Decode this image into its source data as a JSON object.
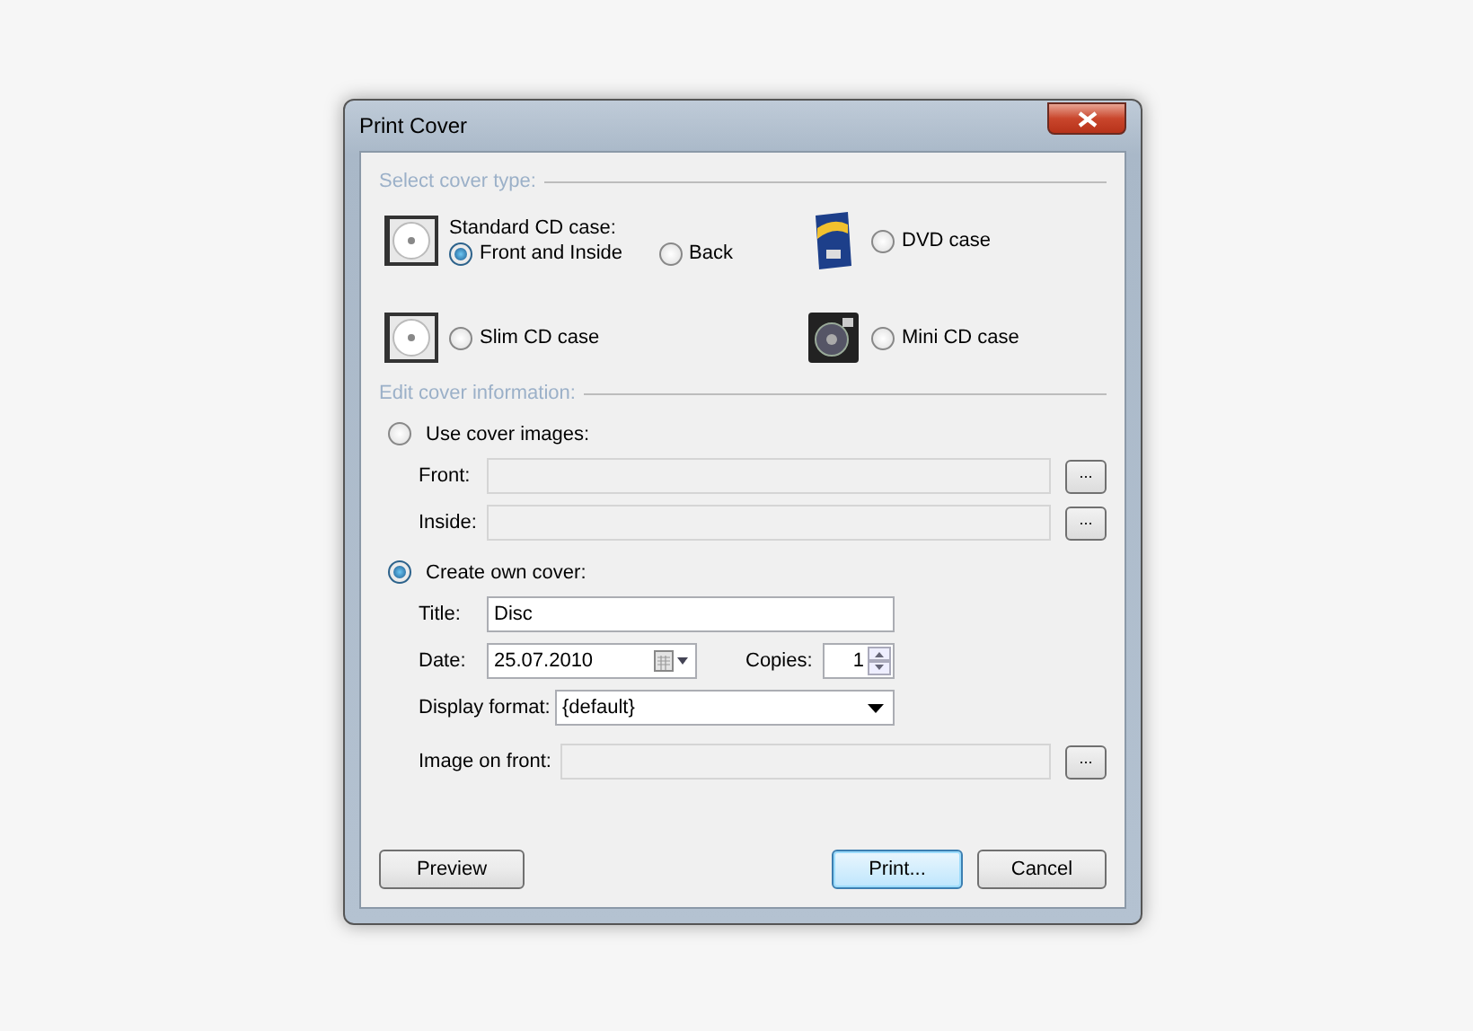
{
  "window": {
    "title": "Print Cover"
  },
  "cover_type": {
    "legend": "Select cover type:",
    "items": [
      {
        "kind": "standard",
        "label": "Standard CD case:",
        "options": [
          {
            "label": "Front and Inside",
            "selected": true
          },
          {
            "label": "Back",
            "selected": false
          }
        ]
      },
      {
        "kind": "dvd",
        "label": "DVD case",
        "selected": false
      },
      {
        "kind": "slim",
        "label": "Slim CD case",
        "selected": false
      },
      {
        "kind": "mini",
        "label": "Mini CD case",
        "selected": false
      }
    ]
  },
  "cover_info": {
    "legend": "Edit cover information:",
    "use_images": {
      "label": "Use cover images:",
      "selected": false,
      "fields": [
        {
          "label": "Front:",
          "button": "..."
        },
        {
          "label": "Inside:",
          "button": "..."
        }
      ]
    },
    "create_own": {
      "label": "Create own cover:",
      "selected": true,
      "title": {
        "label": "Title:",
        "value": "Disc"
      },
      "date": {
        "label": "Date:",
        "value": "25.07.2010"
      },
      "copies": {
        "label": "Copies:",
        "value": "1"
      },
      "display_format": {
        "label": "Display format:",
        "value": "{default}"
      },
      "image_on_front": {
        "label": "Image on front:",
        "button": "..."
      }
    }
  },
  "buttons": [
    {
      "label": "Preview",
      "default": false
    },
    {
      "label": "Print...",
      "default": true
    },
    {
      "label": "Cancel",
      "default": false
    }
  ]
}
